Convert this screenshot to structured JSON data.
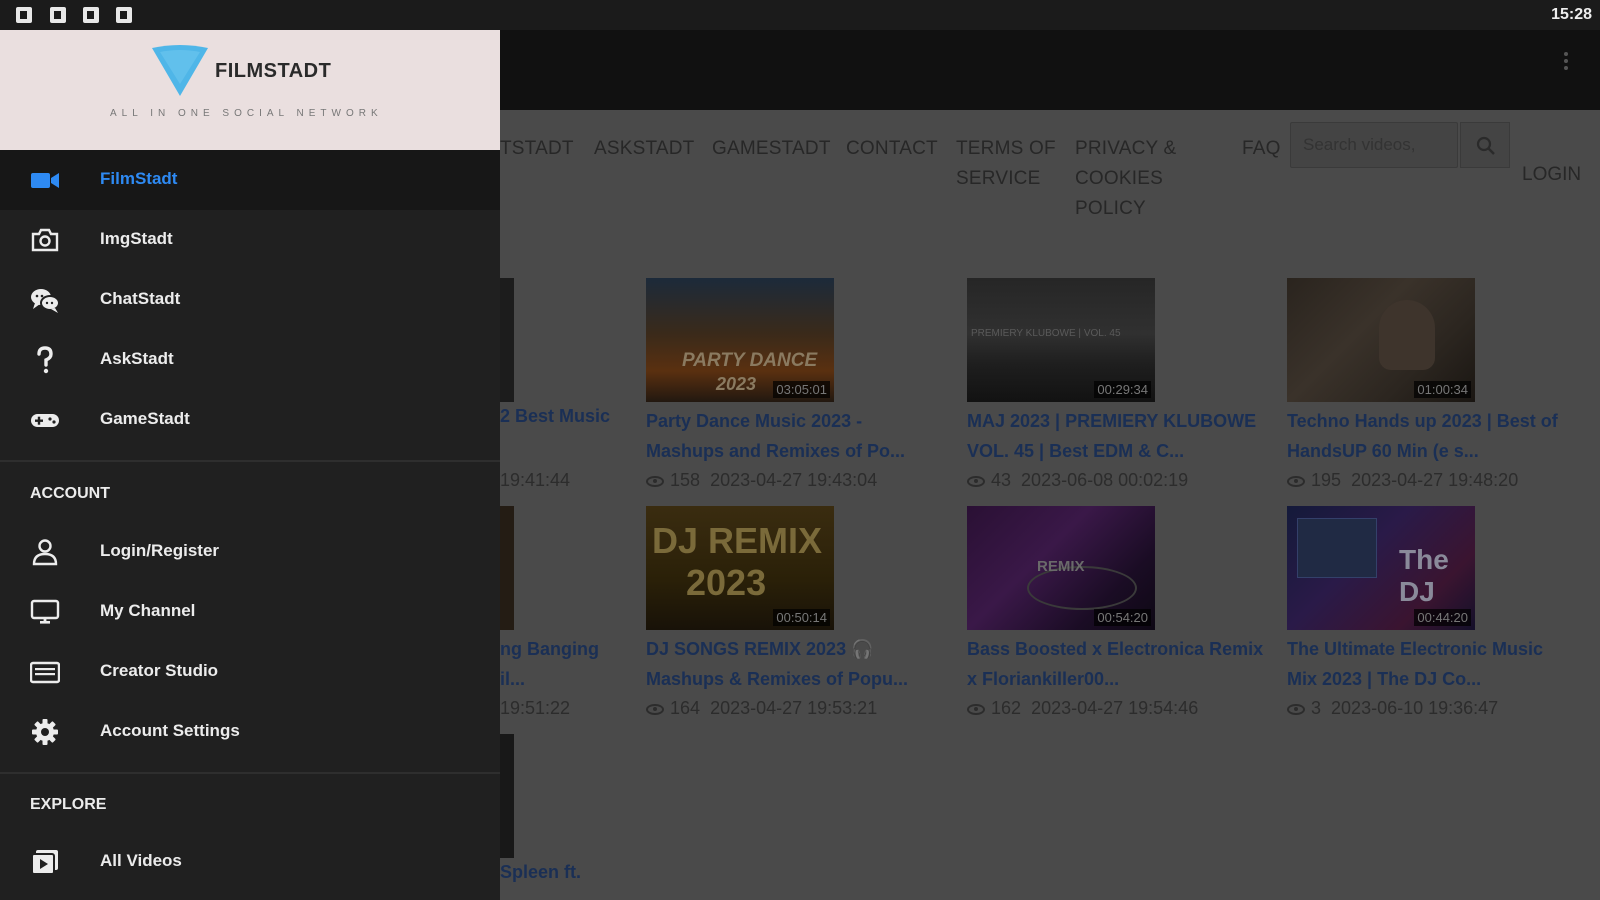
{
  "status_bar": {
    "time": "15:28"
  },
  "drawer": {
    "brand": "FILMSTADT",
    "tagline": "ALL IN ONE SOCIAL NETWORK",
    "apps": [
      {
        "label": "FilmStadt",
        "icon": "video-camera-icon",
        "active": true
      },
      {
        "label": "ImgStadt",
        "icon": "camera-icon"
      },
      {
        "label": "ChatStadt",
        "icon": "chat-bubbles-icon"
      },
      {
        "label": "AskStadt",
        "icon": "question-mark-icon"
      },
      {
        "label": "GameStadt",
        "icon": "gamepad-icon"
      }
    ],
    "account_heading": "ACCOUNT",
    "account": [
      {
        "label": "Login/Register",
        "icon": "user-icon"
      },
      {
        "label": "My Channel",
        "icon": "monitor-icon"
      },
      {
        "label": "Creator Studio",
        "icon": "studio-icon"
      },
      {
        "label": "Account Settings",
        "icon": "gear-icon"
      }
    ],
    "explore_heading": "EXPLORE",
    "explore": [
      {
        "label": "All Videos",
        "icon": "video-library-icon"
      }
    ],
    "accent_color": "#2e8af3"
  },
  "topnav": {
    "partial_link": "TSTADT",
    "askstadt": "ASKSTADT",
    "gamestadt": "GAMESTADT",
    "contact": "CONTACT",
    "terms_1": "TERMS OF",
    "terms_2": "SERVICE",
    "privacy_1": "PRIVACY &",
    "privacy_2": "COOKIES",
    "privacy_3": "POLICY",
    "faq": "FAQ",
    "search_placeholder": "Search videos,",
    "login": "LOGIN"
  },
  "partial_column": {
    "r1_title": "2 Best Music",
    "r1_meta": "19:41:44",
    "r2_title_1": "ng Banging",
    "r2_title_2": "il...",
    "r2_meta": "19:51:22",
    "r3_title": "Spleen ft."
  },
  "videos": [
    {
      "duration": "03:05:01",
      "title_1": "Party Dance Music 2023 -",
      "title_2": "Mashups and Remixes of Po...",
      "views": "158",
      "date": "2023-04-27 19:43:04",
      "thumb_text_1": "PARTY DANCE",
      "thumb_text_2": "2023"
    },
    {
      "duration": "00:29:34",
      "title_1": "MAJ 2023 | PREMIERY KLUBOWE",
      "title_2": "VOL. 45 | Best EDM & C...",
      "views": "43",
      "date": "2023-06-08 00:02:19",
      "thumb_text_1": "PREMIERY KLUBOWE | VOL. 45"
    },
    {
      "duration": "01:00:34",
      "title_1": "Techno Hands up 2023 | Best of",
      "title_2": "HandsUP 60 Min (e s...",
      "views": "195",
      "date": "2023-04-27 19:48:20"
    },
    {
      "duration": "00:50:14",
      "title_1": "DJ SONGS REMIX 2023 🎧",
      "title_2": "Mashups & Remixes of Popu...",
      "views": "164",
      "date": "2023-04-27 19:53:21",
      "thumb_text_1": "DJ REMIX",
      "thumb_text_2": "2023"
    },
    {
      "duration": "00:54:20",
      "title_1": "Bass Boosted x Electronica Remix",
      "title_2": "x Floriankiller00...",
      "views": "162",
      "date": "2023-04-27 19:54:46",
      "thumb_text_1": "REMIX"
    },
    {
      "duration": "00:44:20",
      "title_1": "The Ultimate Electronic Music",
      "title_2": "Mix 2023 | The DJ Co...",
      "views": "3",
      "date": "2023-06-10 19:36:47",
      "thumb_text_1": "The DJ"
    }
  ]
}
